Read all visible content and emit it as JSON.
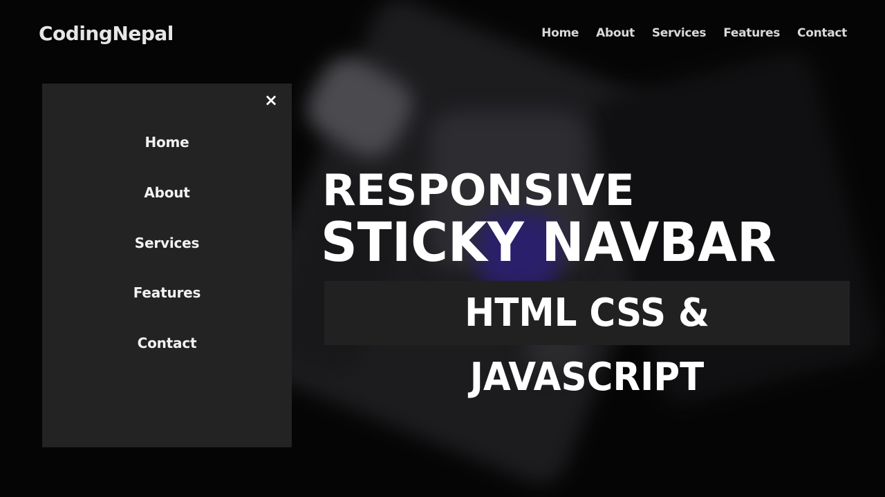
{
  "navbar": {
    "logo": "CodingNepal",
    "links": [
      "Home",
      "About",
      "Services",
      "Features",
      "Contact"
    ]
  },
  "side_menu": {
    "close_label": "×",
    "items": [
      "Home",
      "About",
      "Services",
      "Features",
      "Contact"
    ]
  },
  "hero": {
    "line1": "RESPONSIVE",
    "line2": "STICKY NAVBAR",
    "line3": "HTML CSS & JAVASCRIPT"
  },
  "colors": {
    "background": "#050505",
    "panel": "#232323",
    "text": "#ffffff"
  }
}
